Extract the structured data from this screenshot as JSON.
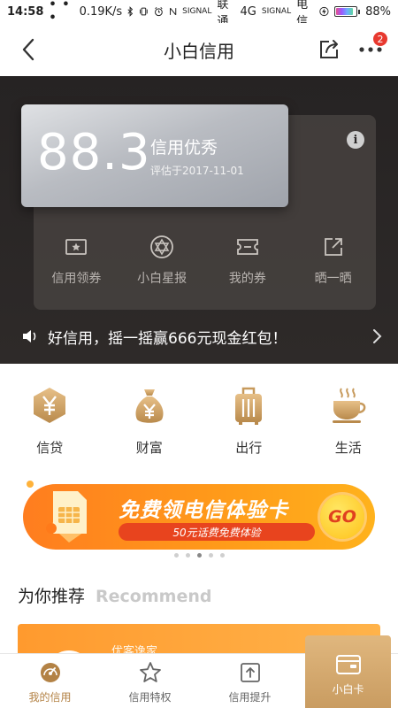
{
  "status_bar": {
    "time": "14:58",
    "dots": "• • •",
    "speed": "0.19K/s",
    "signal_label": "SIGNAL",
    "carrier1": "联通",
    "network": "4G",
    "carrier2": "电信",
    "battery": "88%",
    "battery_level": 0.88
  },
  "header": {
    "title": "小白信用",
    "badge_count": "2"
  },
  "score_card": {
    "score": "88.3",
    "level": "信用优秀",
    "date": "评估于2017-11-01",
    "info_symbol": "i"
  },
  "hero_actions": [
    {
      "label": "信用领券",
      "icon": "coupon-star-icon"
    },
    {
      "label": "小白星报",
      "icon": "star-of-david-icon"
    },
    {
      "label": "我的券",
      "icon": "ticket-icon"
    },
    {
      "label": "晒一晒",
      "icon": "share-out-icon"
    }
  ],
  "notice": {
    "text": "好信用，摇一摇赢666元现金红包！",
    "icon": "speaker-icon"
  },
  "categories": [
    {
      "label": "信贷",
      "icon": "yen-hexagon-icon"
    },
    {
      "label": "财富",
      "icon": "money-bag-icon"
    },
    {
      "label": "出行",
      "icon": "suitcase-icon"
    },
    {
      "label": "生活",
      "icon": "coffee-cup-icon"
    }
  ],
  "banner": {
    "headline": "免费领电信体验卡",
    "sub": "50元话费免费体验",
    "go": "GO",
    "page_count": 5,
    "active_page": 3
  },
  "recommend": {
    "title_cn": "为你推荐",
    "title_en": "Recommend",
    "card_name": "优客逸家"
  },
  "bottom_nav": [
    {
      "label": "我的信用",
      "icon": "gauge-icon",
      "active": true
    },
    {
      "label": "信用特权",
      "icon": "star-outline-icon",
      "active": false
    },
    {
      "label": "信用提升",
      "icon": "upload-box-icon",
      "active": false
    }
  ],
  "nav_card": {
    "label": "小白卡",
    "icon": "wallet-card-icon"
  },
  "colors": {
    "gold": "#b38245",
    "banner_orange": "#ff8f1c",
    "hero_bg": "#262323",
    "badge_red": "#e8392f"
  }
}
